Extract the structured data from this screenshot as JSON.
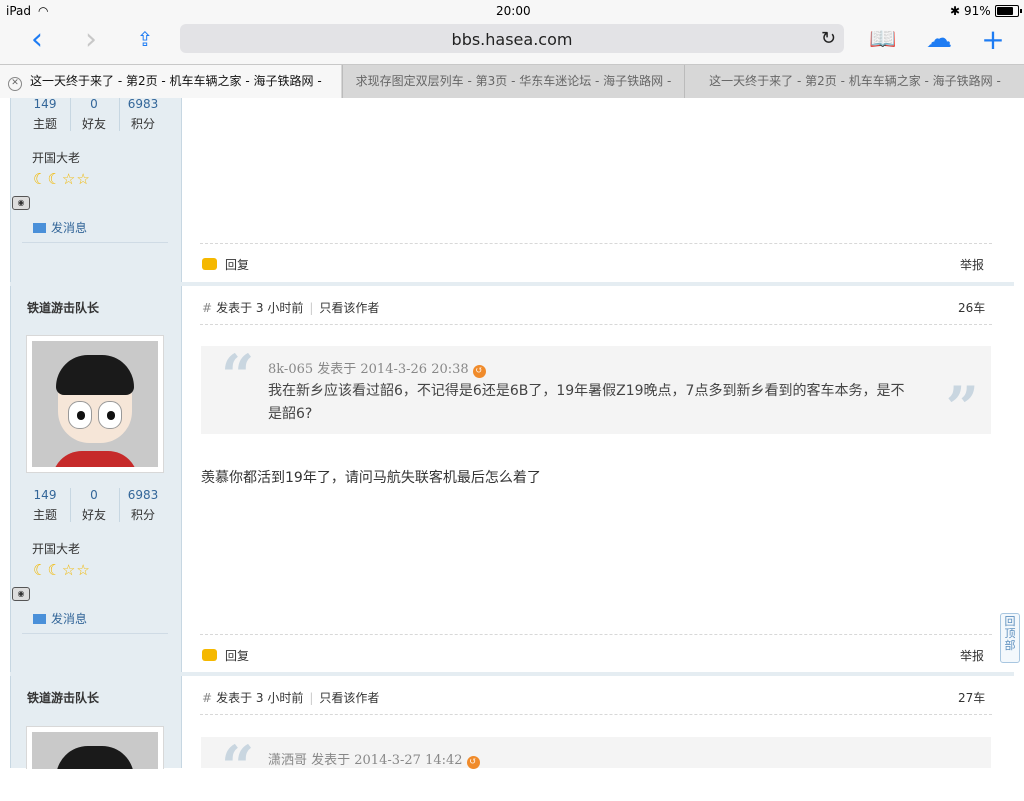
{
  "status": {
    "device": "iPad",
    "time": "20:00",
    "battery": "91%",
    "battery_level": 0.91
  },
  "browser": {
    "url": "bbs.hasea.com",
    "tabs": [
      {
        "title": "这一天终于来了 - 第2页 - 机车车辆之家 - 海子铁路网 -"
      },
      {
        "title": "求现存图定双层列车 - 第3页 - 华东车迷论坛 - 海子铁路网 -"
      },
      {
        "title": "这一天终于来了 - 第2页 - 机车车辆之家 - 海子铁路网 -"
      }
    ]
  },
  "sidebar_common": {
    "stats": [
      {
        "value": "149",
        "label": "主题"
      },
      {
        "value": "0",
        "label": "好友"
      },
      {
        "value": "6983",
        "label": "积分"
      }
    ],
    "rank": "开国大老",
    "stars": "☾☾☆☆",
    "message_link": "发消息"
  },
  "actions": {
    "reply": "回复",
    "report": "举报",
    "back_to_top": "回顶部"
  },
  "posts": [
    {
      "author": "铁道游击队长",
      "posted": "发表于 3 小时前",
      "only_author": "只看该作者",
      "floor": "26车",
      "quote_head": "8k-065 发表于 2014-3-26 20:38",
      "quote_text": "我在新乡应该看过韶6，不记得是6还是6B了，19年暑假Z19晚点，7点多到新乡看到的客车本务，是不是韶6?",
      "message": "羡慕你都活到19年了，请问马航失联客机最后怎么着了"
    },
    {
      "author": "铁道游击队长",
      "posted": "发表于 3 小时前",
      "only_author": "只看该作者",
      "floor": "27车",
      "quote_head": "潇洒哥 发表于 2014-3-27 14:42"
    }
  ]
}
